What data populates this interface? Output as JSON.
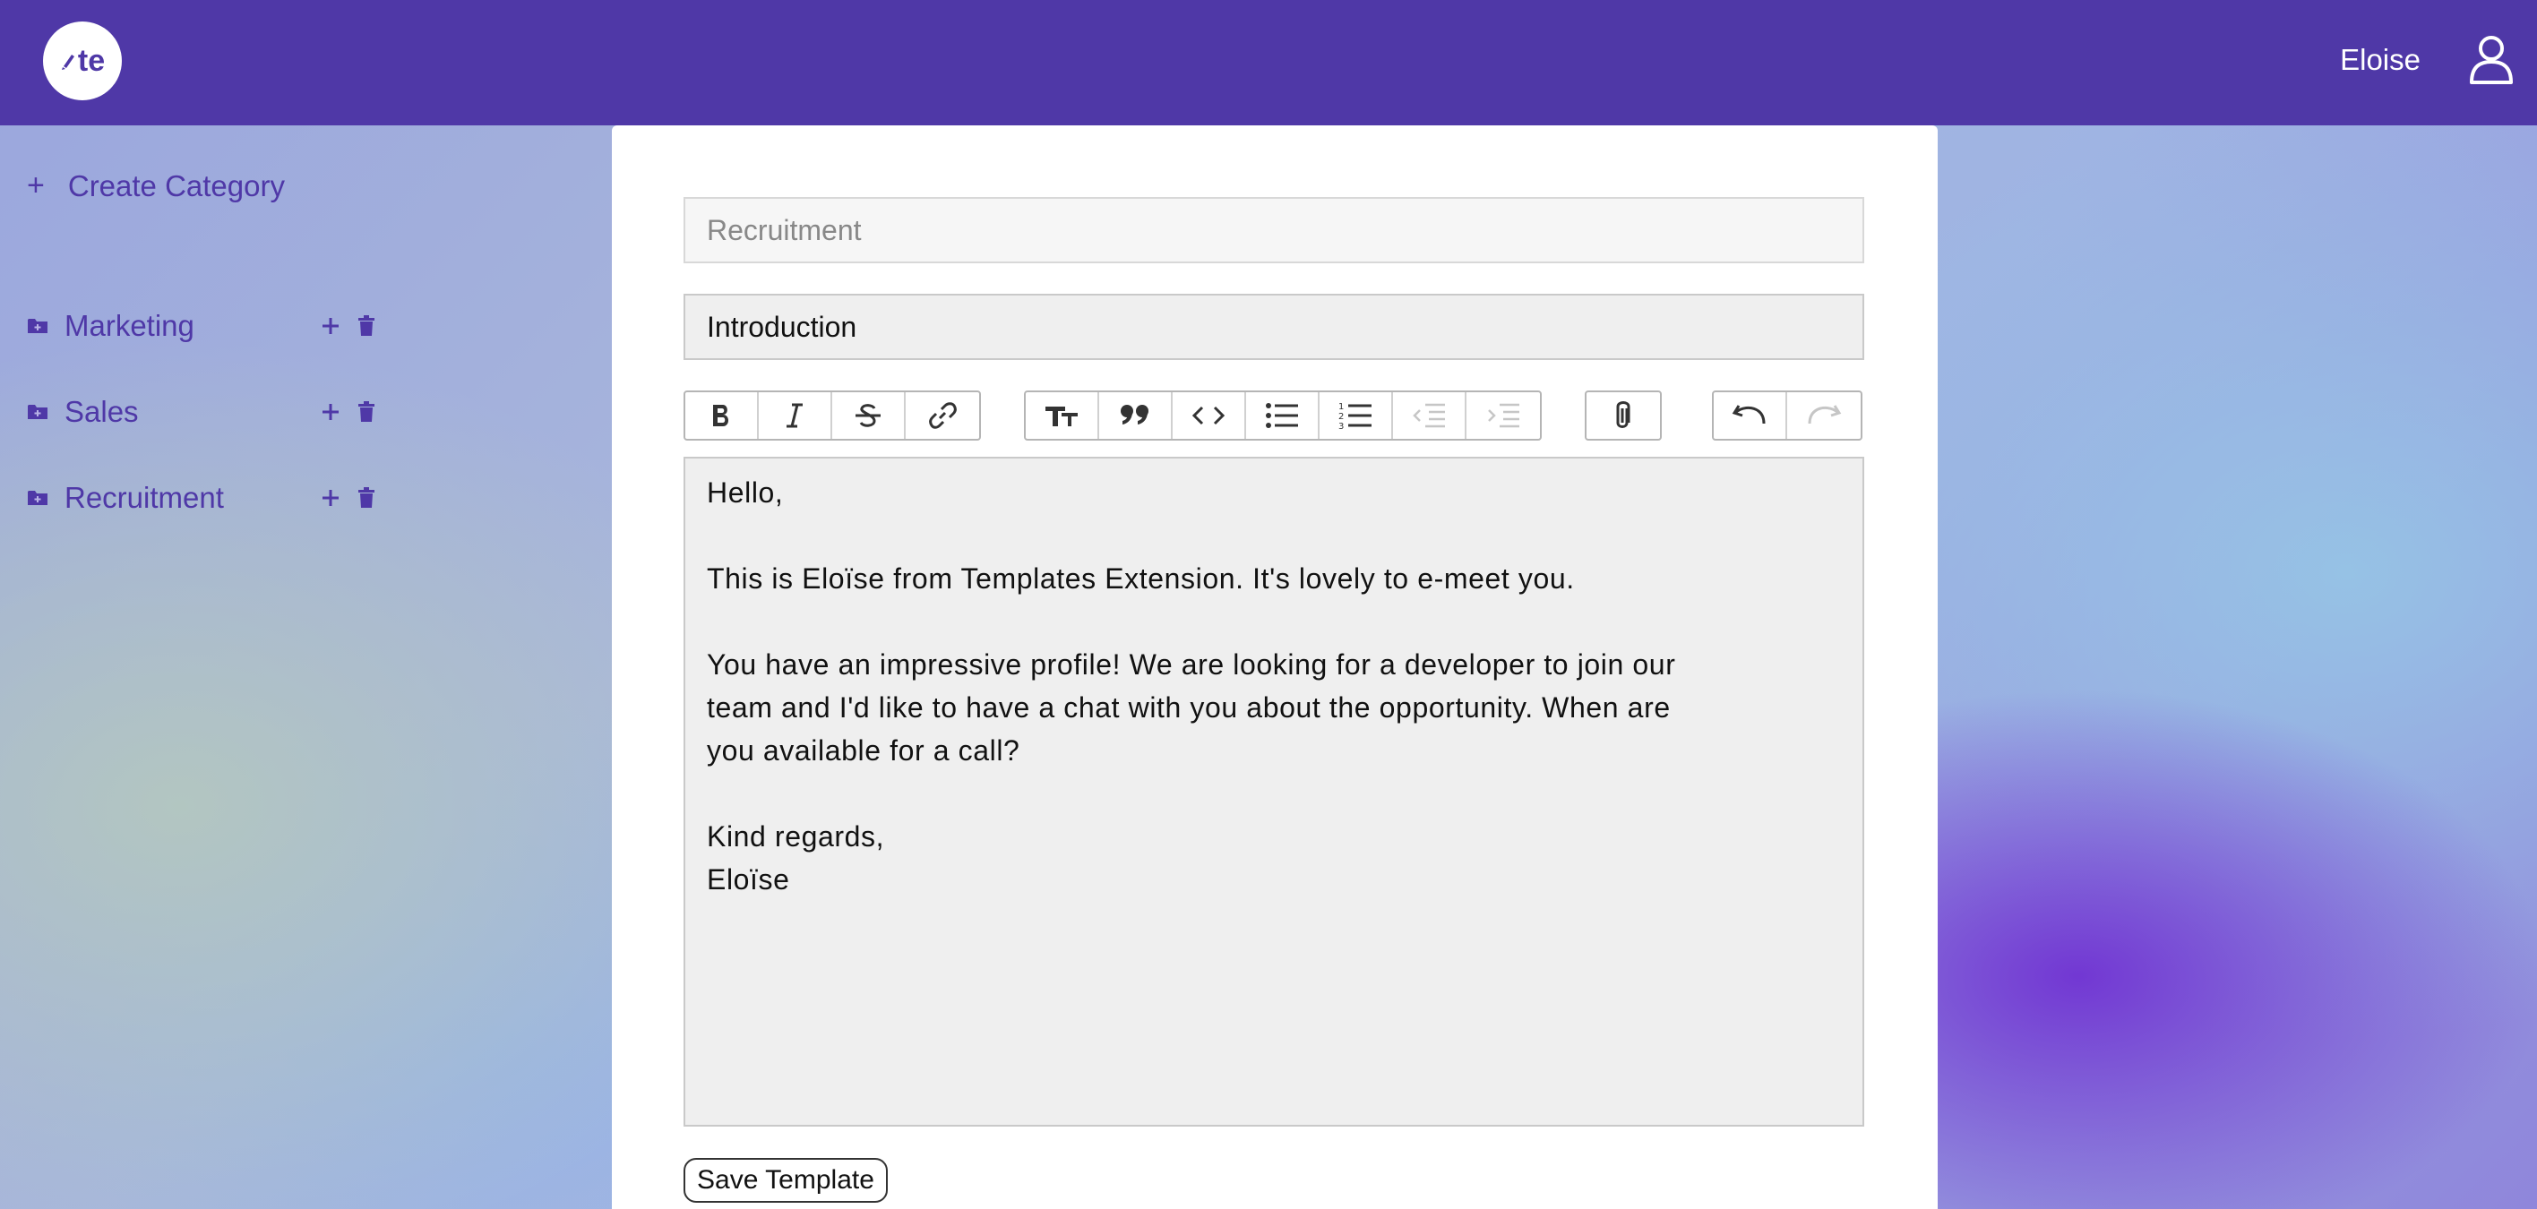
{
  "header": {
    "logo_text": "te",
    "user_name": "Eloise"
  },
  "sidebar": {
    "create_label": "Create Category",
    "categories": [
      {
        "label": "Marketing"
      },
      {
        "label": "Sales"
      },
      {
        "label": "Recruitment"
      }
    ]
  },
  "form": {
    "category_placeholder": "Recruitment",
    "title_value": "Introduction",
    "body_lines": [
      "Hello,",
      "",
      "This is Eloïse from Templates Extension. It's lovely to e-meet you.",
      "",
      "You have an impressive profile! We are looking for a developer to join our",
      "team and I'd like to have a chat with you about the opportunity. When are",
      "you available for a call?",
      "",
      "Kind regards,",
      "Eloïse"
    ],
    "save_label": "Save Template"
  },
  "toolbar_icons": [
    "bold-icon",
    "italic-icon",
    "strikethrough-icon",
    "link-icon",
    "heading-icon",
    "quote-icon",
    "code-icon",
    "bullet-list-icon",
    "numbered-list-icon",
    "decrease-indent-icon",
    "increase-indent-icon",
    "attach-icon",
    "undo-icon",
    "redo-icon"
  ],
  "colors": {
    "brand": "#4f38a7",
    "card": "#ffffff",
    "editor_bg": "#efefef"
  }
}
